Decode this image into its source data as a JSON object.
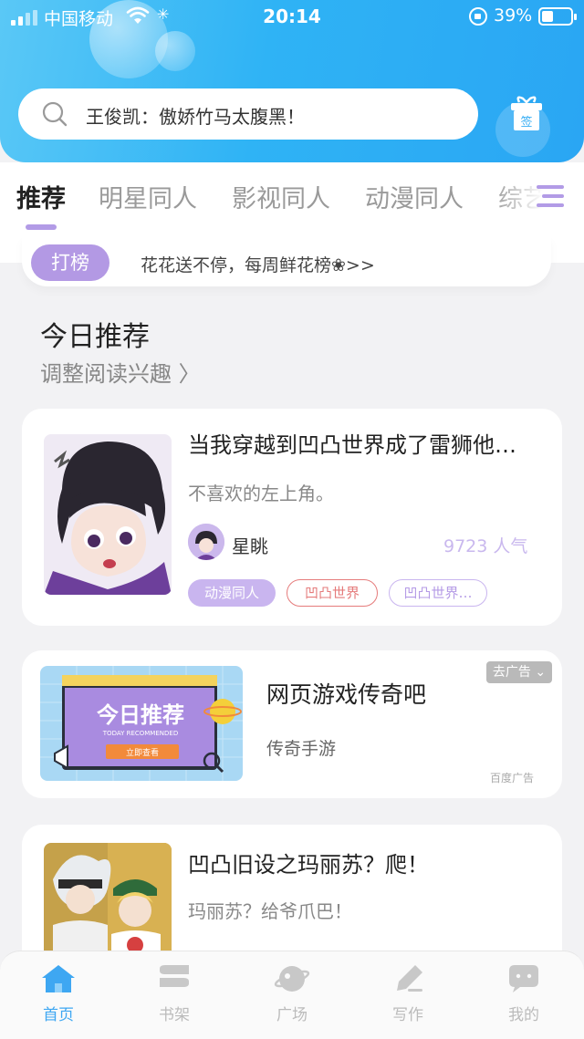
{
  "status_bar": {
    "carrier": "中国移动",
    "time": "20:14",
    "battery": "39%"
  },
  "search": {
    "placeholder": "王俊凯：傲娇竹马太腹黑！"
  },
  "gift": {
    "label": "签"
  },
  "tabs": [
    {
      "label": "推荐",
      "active": true
    },
    {
      "label": "明星同人"
    },
    {
      "label": "影视同人"
    },
    {
      "label": "动漫同人"
    },
    {
      "label": "综艺"
    }
  ],
  "notice": {
    "button_label": "打榜",
    "text": "花花送不停，每周鲜花榜❀>>"
  },
  "section": {
    "title": "今日推荐",
    "subtitle": "调整阅读兴趣 〉"
  },
  "books": [
    {
      "title": "当我穿越到凹凸世界成了雷狮他…",
      "description": "不喜欢的左上角。",
      "author": "星眺",
      "popularity": "9723 人气",
      "tags": [
        "动漫同人",
        "凹凸世界",
        "凹凸世界…"
      ]
    },
    {
      "title": "凹凸旧设之玛丽苏？爬！",
      "description": "玛丽苏？给爷爪巴！"
    }
  ],
  "ad": {
    "close_label": "去广告 ⌄",
    "title": "网页游戏传奇吧",
    "subtitle": "传奇手游",
    "source": "百度广告",
    "banner_title": "今日推荐",
    "banner_sub": "TODAY RECOMMENDED",
    "banner_button": "立即查看"
  },
  "bottom_nav": [
    {
      "label": "首页",
      "icon": "home-icon",
      "active": true
    },
    {
      "label": "书架",
      "icon": "bookshelf-icon"
    },
    {
      "label": "广场",
      "icon": "planet-icon"
    },
    {
      "label": "写作",
      "icon": "pen-icon"
    },
    {
      "label": "我的",
      "icon": "chat-bubble-icon"
    }
  ],
  "colors": {
    "header_blue": "#2fb3f5",
    "accent_purple": "#b399e4",
    "active_nav": "#3ea7f2"
  }
}
